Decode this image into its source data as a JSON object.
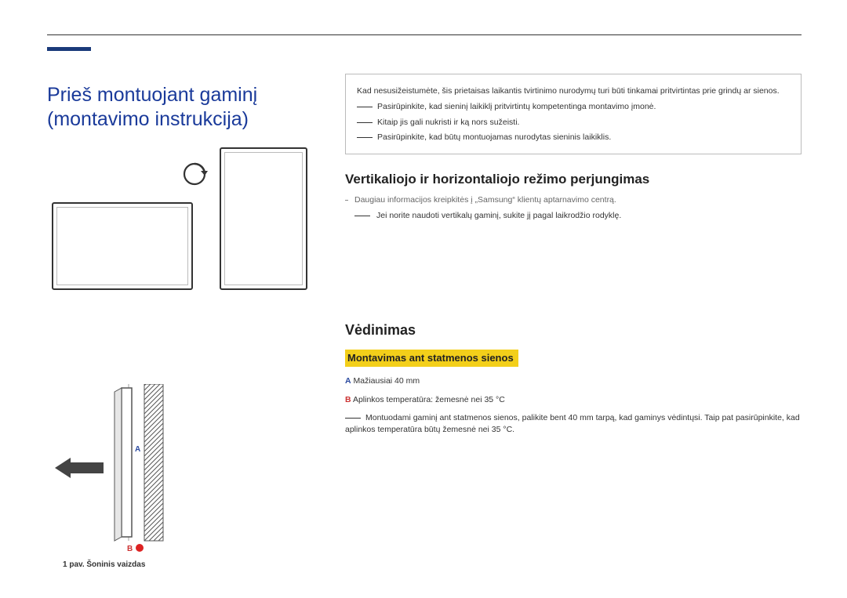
{
  "title": "Prieš montuojant gaminį (montavimo instrukcija)",
  "note_box": {
    "line1": "Kad nesusižeistumėte, šis prietaisas laikantis tvirtinimo nurodymų turi būti tinkamai pritvirtintas prie grindų ar sienos.",
    "note1": "Pasirūpinkite, kad sieninį laikiklį pritvirtintų kompetentinga montavimo įmonė.",
    "note2": "Kitaip jis gali nukristi ir ką nors sužeisti.",
    "note3": "Pasirūpinkite, kad būtų montuojamas nurodytas sieninis laikiklis.",
    "note_label": "――"
  },
  "section_rotate": {
    "heading": "Vertikaliojo ir horizontaliojo režimo perjungimas",
    "bullet": "Daugiau informacijos kreipkitės į „Samsung“ klientų aptarnavimo centrą.",
    "note_label": "――",
    "note": "Jei norite naudoti vertikalų gaminį, sukite jį pagal laikrodžio rodyklę."
  },
  "section_vent": {
    "heading": "Vėdinimas",
    "sub_heading": "Montavimas ant statmenos sienos",
    "specA_key": "A",
    "specA_val": "Mažiausiai 40 mm",
    "specB_key": "B",
    "specB_val": "Aplinkos temperatūra: žemesnė nei 35 °C",
    "note_label": "――",
    "note": "Montuodami gaminį ant statmenos sienos, palikite bent 40 mm tarpą, kad gaminys vėdintųsi. Taip pat pasirūpinkite, kad aplinkos temperatūra būtų žemesnė nei 35   °C."
  },
  "side_view": {
    "caption": "1 pav. Šoninis vaizdas",
    "labelA": "A",
    "labelB": "B"
  },
  "icons": {
    "rotate": "rotate-cw-icon",
    "arrow_left": "arrow-left-icon"
  }
}
